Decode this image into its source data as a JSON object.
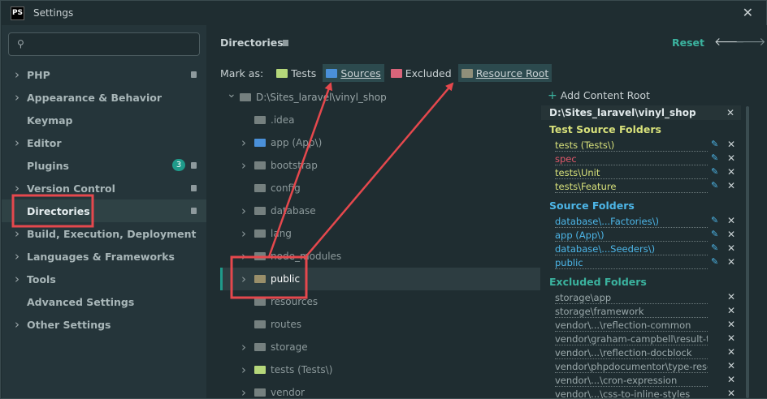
{
  "window": {
    "app_icon_text": "PS",
    "title": "Settings",
    "close_glyph": "✕"
  },
  "sidebar": {
    "search_placeholder": "",
    "items": [
      {
        "label": "PHP",
        "chevron": true,
        "badge": true
      },
      {
        "label": "Appearance & Behavior",
        "chevron": true
      },
      {
        "label": "Keymap",
        "chevron": false
      },
      {
        "label": "Editor",
        "chevron": true
      },
      {
        "label": "Plugins",
        "chevron": false,
        "count": "3",
        "badge": true
      },
      {
        "label": "Version Control",
        "chevron": true,
        "badge": true
      },
      {
        "label": "Directories",
        "chevron": false,
        "badge": true,
        "selected": true
      },
      {
        "label": "Build, Execution, Deployment",
        "chevron": true
      },
      {
        "label": "Languages & Frameworks",
        "chevron": true
      },
      {
        "label": "Tools",
        "chevron": true
      },
      {
        "label": "Advanced Settings",
        "chevron": false
      },
      {
        "label": "Other Settings",
        "chevron": true
      }
    ]
  },
  "main": {
    "heading": "Directories",
    "reset": "Reset",
    "back_glyph": "🡐",
    "forward_glyph": "🡒",
    "mark_as": {
      "label": "Mark as:",
      "buttons": [
        {
          "label": "Tests",
          "color": "#b5d77a"
        },
        {
          "label": "Sources",
          "color": "#4a90d9"
        },
        {
          "label": "Excluded",
          "color": "#d9647a"
        },
        {
          "label": "Resource Root",
          "color": "#8f8f7a"
        }
      ]
    },
    "tree": [
      {
        "label": "D:\\Sites_laravel\\vinyl_shop",
        "chevron": "down",
        "depth": 0
      },
      {
        "label": ".idea",
        "chevron": "",
        "depth": 1
      },
      {
        "label": "app (App\\)",
        "chevron": "right",
        "depth": 1,
        "color": "#4a90d9"
      },
      {
        "label": "bootstrap",
        "chevron": "right",
        "depth": 1
      },
      {
        "label": "config",
        "chevron": "",
        "depth": 1
      },
      {
        "label": "database",
        "chevron": "right",
        "depth": 1
      },
      {
        "label": "lang",
        "chevron": "right",
        "depth": 1
      },
      {
        "label": "node_modules",
        "chevron": "right",
        "depth": 1
      },
      {
        "label": "public",
        "chevron": "right",
        "depth": 1,
        "selected": true
      },
      {
        "label": "resources",
        "chevron": "",
        "depth": 1
      },
      {
        "label": "routes",
        "chevron": "",
        "depth": 1
      },
      {
        "label": "storage",
        "chevron": "right",
        "depth": 1
      },
      {
        "label": "tests (Tests\\)",
        "chevron": "right",
        "depth": 1,
        "color": "#b5d77a"
      },
      {
        "label": "vendor",
        "chevron": "right",
        "depth": 1
      }
    ],
    "right": {
      "add_content_root": "Add Content Root",
      "root_path": "D:\\Sites_laravel\\vinyl_shop",
      "test_source_title": "Test Source Folders",
      "test_sources": [
        {
          "label": "tests (Tests\\)",
          "color": "#d7e07a"
        },
        {
          "label": "spec",
          "color": "#e0586a"
        },
        {
          "label": "tests\\Unit",
          "color": "#d7e07a"
        },
        {
          "label": "tests\\Feature",
          "color": "#d7e07a"
        }
      ],
      "source_title": "Source Folders",
      "sources": [
        {
          "label": "database\\...Factories\\)"
        },
        {
          "label": "app (App\\)"
        },
        {
          "label": "database\\...Seeders\\)"
        },
        {
          "label": "public"
        }
      ],
      "excluded_title": "Excluded Folders",
      "excluded": [
        {
          "label": "storage\\app"
        },
        {
          "label": "storage\\framework"
        },
        {
          "label": "vendor\\...\\reflection-common"
        },
        {
          "label": "vendor\\graham-campbell\\result-type"
        },
        {
          "label": "vendor\\...\\reflection-docblock"
        },
        {
          "label": "vendor\\phpdocumentor\\type-resolver"
        },
        {
          "label": "vendor\\...\\cron-expression"
        },
        {
          "label": "vendor\\...\\css-to-inline-styles"
        }
      ]
    }
  },
  "colors": {
    "accent": "#3bb39f",
    "annotation_red": "#e5484d",
    "source_blue": "#4db6e8",
    "test_yellow": "#d7e07a",
    "excluded_text": "#9aa8aa"
  }
}
